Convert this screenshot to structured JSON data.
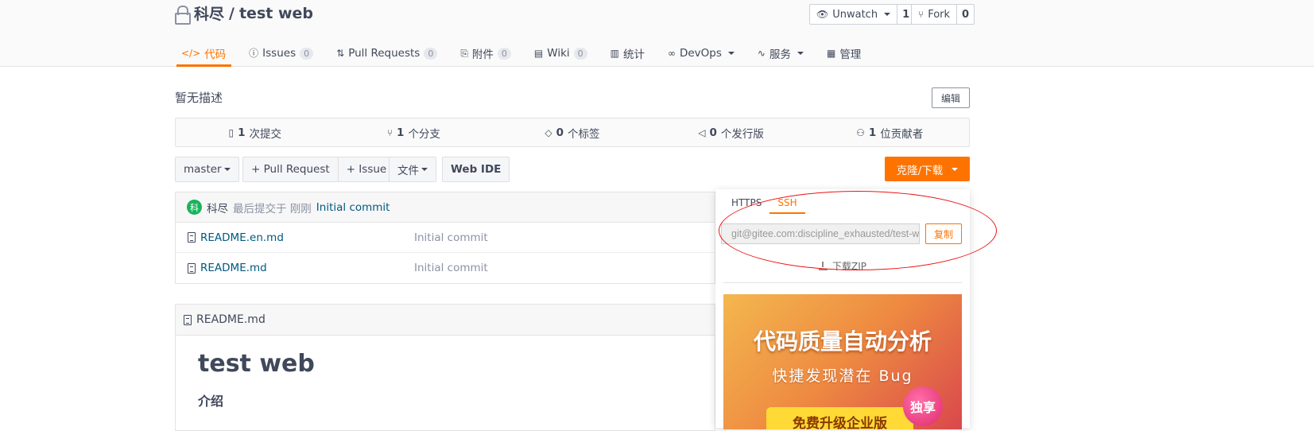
{
  "repo": {
    "owner": "科尽",
    "sep": " / ",
    "name": "test web"
  },
  "header_buttons": {
    "watch": {
      "label": "Unwatch",
      "count": "1"
    },
    "fork": {
      "label": "Fork",
      "count": "0"
    }
  },
  "tabs": [
    {
      "label": "代码",
      "icon": "code-icon"
    },
    {
      "label": "Issues",
      "badge": "0",
      "icon": "issue-icon"
    },
    {
      "label": "Pull Requests",
      "badge": "0",
      "icon": "pull-request-icon"
    },
    {
      "label": "附件",
      "badge": "0",
      "icon": "paperclip-icon"
    },
    {
      "label": "Wiki",
      "badge": "0",
      "icon": "book-icon"
    },
    {
      "label": "统计",
      "icon": "bar-chart-icon"
    },
    {
      "label": "DevOps",
      "icon": "infinity-icon"
    },
    {
      "label": "服务",
      "icon": "pulse-icon"
    },
    {
      "label": "管理",
      "icon": "settings-doc-icon"
    }
  ],
  "description": "暂无描述",
  "edit_label": "编辑",
  "stats": [
    {
      "num": "1",
      "label": " 次提交",
      "icon": "commit-doc-icon"
    },
    {
      "num": "1",
      "label": " 个分支",
      "icon": "branch-icon"
    },
    {
      "num": "0",
      "label": " 个标签",
      "icon": "tag-icon"
    },
    {
      "num": "0",
      "label": " 个发行版",
      "icon": "release-icon"
    },
    {
      "num": "1",
      "label": " 位贡献者",
      "icon": "contributors-icon"
    }
  ],
  "toolbar": {
    "branch": "master",
    "pull_request": "+ Pull Request",
    "issue": "+ Issue",
    "files": "文件",
    "web_ide": "Web IDE",
    "clone": "克隆/下载"
  },
  "last_commit": {
    "avatar": "科",
    "author": "科尽",
    "text": "最后提交于 刚刚",
    "message": "Initial commit"
  },
  "files": [
    {
      "name": "README.en.md",
      "message": "Initial commit"
    },
    {
      "name": "README.md",
      "message": "Initial commit"
    }
  ],
  "readme": {
    "file": "README.md",
    "title": "test web",
    "section": "介绍"
  },
  "clone_panel": {
    "tab_https": "HTTPS",
    "tab_ssh": "SSH",
    "url": "git@gitee.com:discipline_exhausted/test-web.git",
    "copy": "复制",
    "download": "下载ZIP"
  },
  "banner": {
    "line1": "代码质量自动分析",
    "line2": "快捷发现潜在 Bug",
    "badge": "独享",
    "button": "免费升级企业版"
  },
  "colors": {
    "accent": "#fe7300",
    "link": "#005980",
    "annotation": "#ee1111"
  }
}
